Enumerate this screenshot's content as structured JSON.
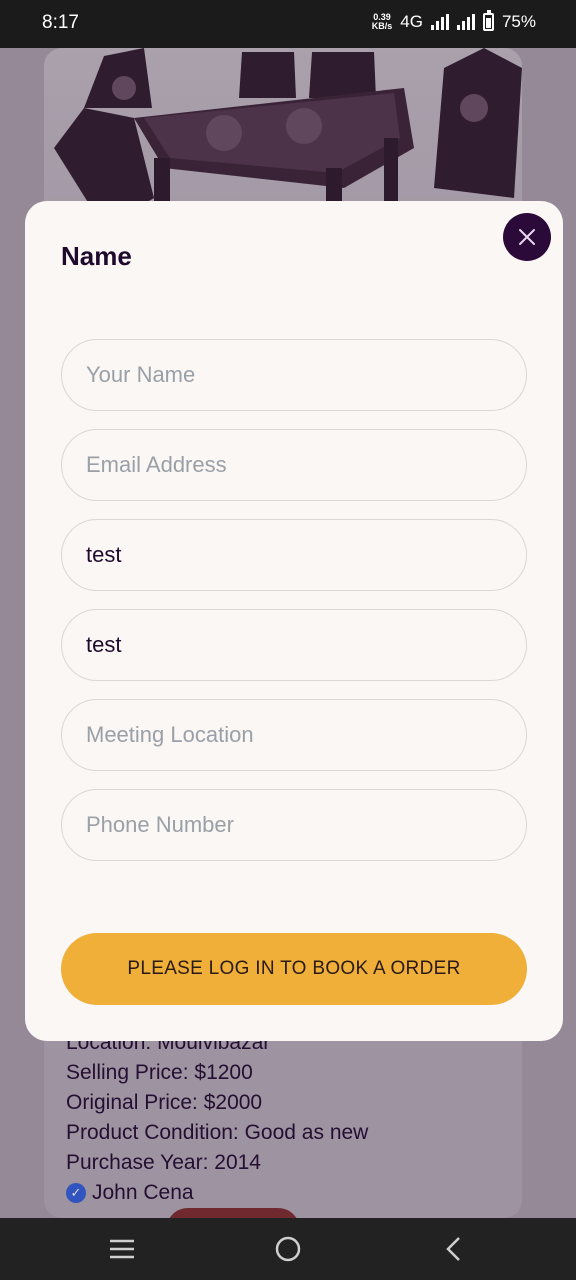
{
  "status_bar": {
    "time": "8:17",
    "net_speed_value": "0.39",
    "net_speed_unit": "KB/s",
    "network": "4G",
    "battery": "75%"
  },
  "product": {
    "location": "Location: Moulvibazar",
    "selling_price": "Selling Price: $1200",
    "original_price": "Original Price: $2000",
    "condition": "Product Condition: Good as new",
    "purchase_year": "Purchase Year: 2014",
    "seller": "John Cena"
  },
  "modal": {
    "title": "Name",
    "fields": [
      {
        "placeholder": "Your Name",
        "value": ""
      },
      {
        "placeholder": "Email Address",
        "value": ""
      },
      {
        "placeholder": "",
        "value": "test"
      },
      {
        "placeholder": "",
        "value": "test"
      },
      {
        "placeholder": "Meeting Location",
        "value": ""
      },
      {
        "placeholder": "Phone Number",
        "value": ""
      }
    ],
    "submit_label": "PLEASE LOG IN TO BOOK A ORDER"
  },
  "colors": {
    "accent": "#efaf38",
    "close_button": "#2b0a3a",
    "text_dark": "#1f0a2e",
    "verified": "#2f5ed8"
  }
}
